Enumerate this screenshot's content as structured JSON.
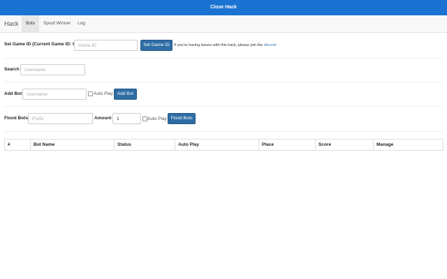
{
  "topbar": {
    "label": "Close Hack"
  },
  "navbar": {
    "brand": "Hack",
    "tabs": [
      {
        "label": "Bots",
        "active": true
      },
      {
        "label": "Spoof Winner",
        "active": false
      },
      {
        "label": "Log",
        "active": false
      }
    ]
  },
  "game_id": {
    "label": "Set Game ID (Current Game ID: 0)",
    "placeholder": "Game ID",
    "value": "",
    "button": "Set Game ID",
    "help_text": "If you're having issues with this hack, please join the",
    "help_link": "discord"
  },
  "search": {
    "label": "Search",
    "placeholder": "Username",
    "value": ""
  },
  "add_bot": {
    "label": "Add Bot",
    "placeholder": "Username",
    "value": "",
    "autoplay_label": "Auto Play",
    "autoplay_checked": false,
    "button": "Add Bot"
  },
  "flood_bots": {
    "label": "Flood Bots",
    "prefix_placeholder": "Prefix",
    "prefix_value": "",
    "amount_label": "Amount",
    "amount_value": "1",
    "autoplay_label": "Auto Play",
    "autoplay_checked": false,
    "button": "Flood Bots"
  },
  "table": {
    "columns": [
      "#",
      "Bot Name",
      "Status",
      "Auto Play",
      "Place",
      "Score",
      "Manage"
    ],
    "rows": []
  }
}
